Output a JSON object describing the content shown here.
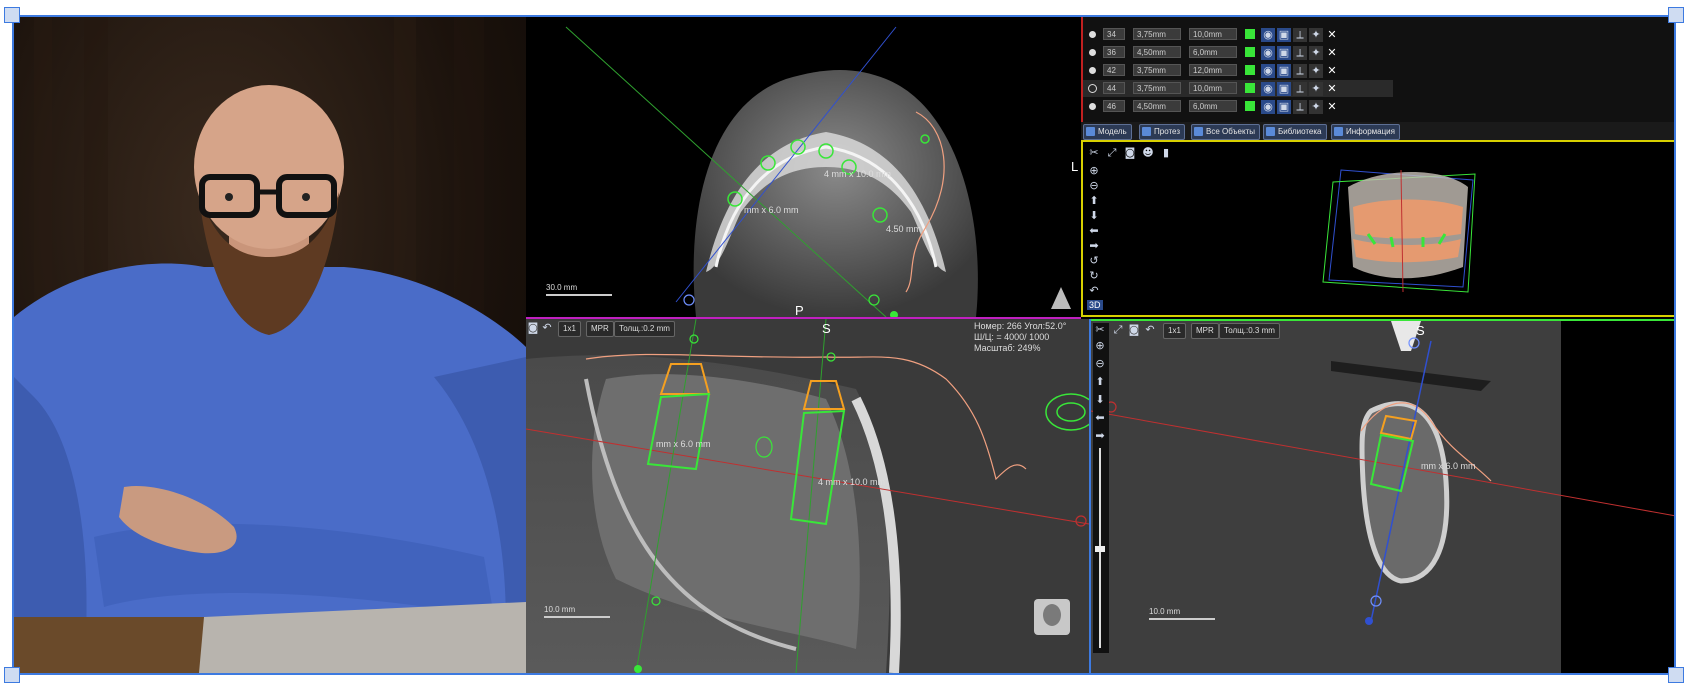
{
  "implant_table": {
    "rows": [
      {
        "tooth": "34",
        "diameter": "3,75mm",
        "length": "10,0mm"
      },
      {
        "tooth": "36",
        "diameter": "4,50mm",
        "length": "6,0mm"
      },
      {
        "tooth": "42",
        "diameter": "3,75mm",
        "length": "12,0mm"
      },
      {
        "tooth": "44",
        "diameter": "3,75mm",
        "length": "10,0mm"
      },
      {
        "tooth": "46",
        "diameter": "4,50mm",
        "length": "6,0mm"
      }
    ]
  },
  "tabs": {
    "model": "Модель",
    "prosthesis": "Протез",
    "all_objects": "Все Объекты",
    "library": "Библиотека",
    "info": "Информация"
  },
  "axial_view": {
    "label_top": "L",
    "label_bottom": "P",
    "scale": "30.0 mm",
    "measure_1": "4 mm x 10.0 mm",
    "measure_2": "mm x 6.0 mm",
    "measure_3": "4.50 mm"
  },
  "panoramic_view": {
    "label": "S",
    "view_mode": "1x1",
    "mpr": "MPR",
    "thickness": "Толщ.:0.2 mm",
    "info_line_1": "Номер: 266 Угол:52.0°",
    "info_line_2": "Ш/Ц: = 4000/ 1000",
    "info_line_3": "Масштаб: 249%",
    "measure": "4 mm x 10.0 mm",
    "measure_left": "mm x 6.0 mm",
    "scale": "10.0 mm"
  },
  "cross_view": {
    "label": "S",
    "view_mode": "1x1",
    "mpr": "MPR",
    "thickness": "Толщ.:0.3 mm",
    "measure": "mm x 6.0 mm",
    "scale": "10.0 mm"
  },
  "three_d_view": {
    "badge": "3D"
  },
  "colors": {
    "frame_border": "#3d7ae0",
    "implant_green": "#39e639",
    "abutment_orange": "#f5a020",
    "nerve_salmon": "#f0a080",
    "axis_red": "#c03030",
    "axis_blue": "#3050d0",
    "panel_yellow": "#d8d000"
  },
  "icons": [
    "eye-icon",
    "lock-icon",
    "delete-icon",
    "camera-icon",
    "zoom-in-icon",
    "zoom-out-icon",
    "arrow-up-icon",
    "arrow-down-icon",
    "rotate-icon",
    "undo-icon",
    "tool-icon",
    "head-icon"
  ]
}
